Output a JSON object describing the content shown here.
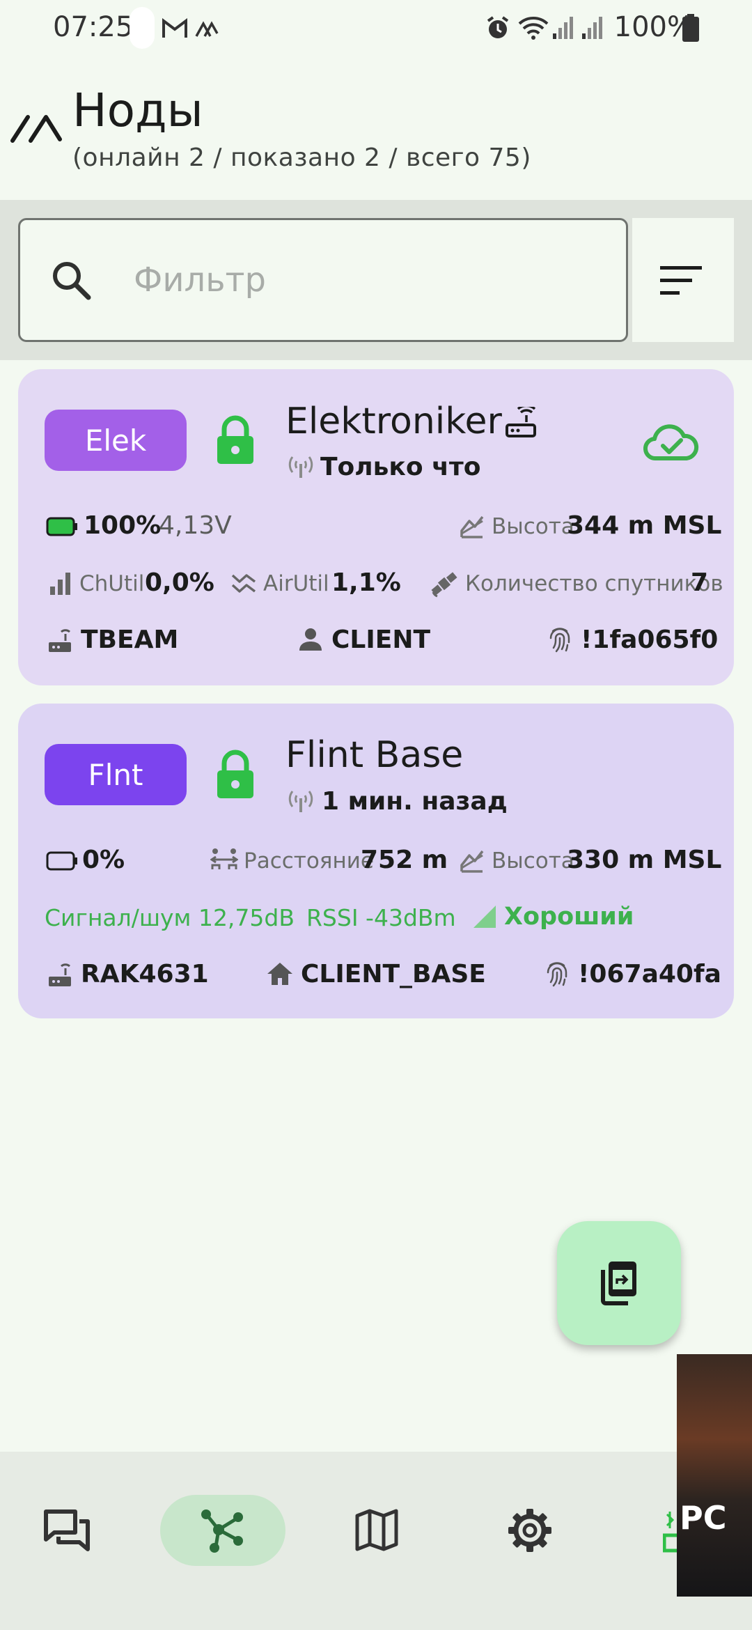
{
  "status_bar": {
    "time": "07:25",
    "battery": "100%"
  },
  "header": {
    "title": "Ноды",
    "subtitle": "(онлайн 2 / показано 2 / всего 75)"
  },
  "filter": {
    "placeholder": "Фильтр"
  },
  "nodes": [
    {
      "short_name": "Elek",
      "long_name": "Elektroniker",
      "last_heard": "Только что",
      "battery_percent": "100%",
      "battery_level": 1.0,
      "voltage": "4,13V",
      "altitude_label": "Высота",
      "altitude": "344 m MSL",
      "chutil_label": "ChUtil",
      "chutil": "0,0%",
      "airutil_label": "AirUtil",
      "airutil": "1,1%",
      "sats_label": "Количество спутников",
      "sats": "7",
      "hardware": "TBEAM",
      "role": "CLIENT",
      "node_id": "!1fa065f0",
      "chip_color": "#a360e8"
    },
    {
      "short_name": "Flnt",
      "long_name": "Flint Base",
      "last_heard": "1 мин. назад",
      "battery_percent": "0%",
      "battery_level": 0.0,
      "distance_label": "Расстояние",
      "distance": "752 m",
      "altitude_label": "Высота",
      "altitude": "330 m MSL",
      "snr": "Сигнал/шум 12,75dB",
      "rssi": "RSSI -43dBm",
      "quality": "Хороший",
      "hardware": "RAK4631",
      "role": "CLIENT_BASE",
      "node_id": "!067a40fa",
      "chip_color": "#7c44ee"
    }
  ],
  "ad": {
    "text": "PC"
  },
  "colors": {
    "accent_green": "#3db14d",
    "lock_green": "#2fbf47",
    "background": "#f3f9f1"
  }
}
